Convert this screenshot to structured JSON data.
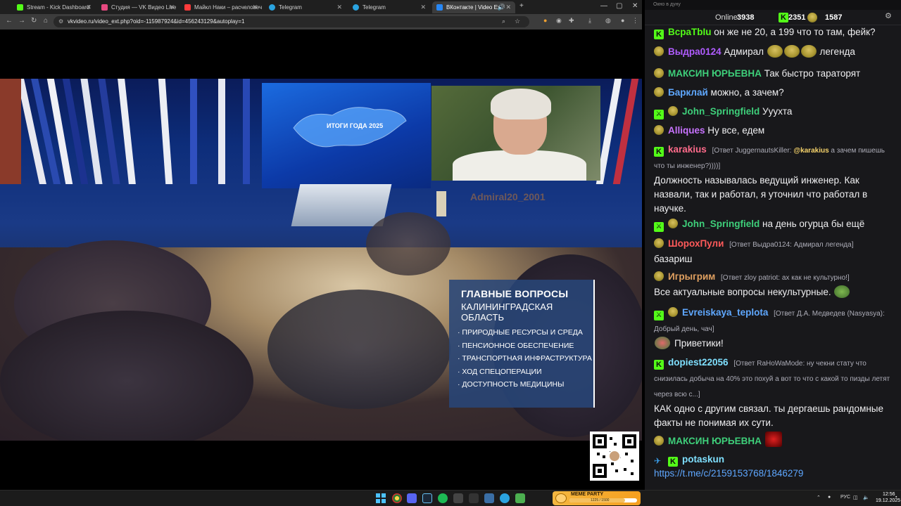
{
  "browser": {
    "tabs": [
      {
        "label": "Stream - Kick Dashboard",
        "color": "#53fc18"
      },
      {
        "label": "Студия — VK Видео Live",
        "color": "#e64980"
      },
      {
        "label": "Майкл Наки – расчеловечива...",
        "color": "#ff3b3b"
      },
      {
        "label": "Telegram",
        "color": "#2aa3e0"
      },
      {
        "label": "Telegram",
        "color": "#2aa3e0"
      },
      {
        "label": "ВКонтакте | Video Ext",
        "color": "#2787f5"
      }
    ],
    "new_tab": "+",
    "url": "vkvideo.ru/video_ext.php?oid=-115987924&id=456243129&autoplay=1",
    "minimize": "—",
    "maximize": "▢",
    "close": "✕"
  },
  "video": {
    "screen_text": "ИТОГИ ГОДА 2025",
    "watermark": "Admiral20_2001",
    "topics_title": "ГЛАВНЫЕ ВОПРОСЫ",
    "topics_subtitle": "КАЛИНИНГРАДСКАЯ ОБЛАСТЬ",
    "topics": [
      "· ПРИРОДНЫЕ РЕСУРСЫ И СРЕДА",
      "· ПЕНСИОННОЕ ОБЕСПЕЧЕНИЕ",
      "· ТРАНСПОРТНАЯ ИНФРАСТРУКТУРА",
      "· ХОД СПЕЦОПЕРАЦИИ",
      "· ДОСТУПНОСТЬ МЕДИЦИНЫ"
    ]
  },
  "chat": {
    "window_title": "Окно в дуну",
    "online_label": "Online:",
    "online_count": "3938",
    "kick_count": "2351",
    "pepe_count": "1587",
    "messages": [
      {
        "badges": [
          "k"
        ],
        "user": "ВсраТbIu",
        "user_color": "#53fc18",
        "text": "он же не 20, а 199 что то там, фейк?"
      },
      {
        "badges": [
          "pepe"
        ],
        "user": "Выдра0124",
        "user_color": "#b05cff",
        "text": "Адмирал",
        "emotes": 3,
        "text_after": "легенда"
      },
      {
        "badges": [
          "pepe"
        ],
        "user": "МАКСИН ЮРЬЕВНА",
        "user_color": "#3ecf7a",
        "text": "Так быстро тараторят"
      },
      {
        "badges": [
          "pepe"
        ],
        "user": "Барклай",
        "user_color": "#5fa8ff",
        "text": "можно, а зачем?"
      },
      {
        "badges": [
          "sword",
          "pepe"
        ],
        "user": "John_Springfield",
        "user_color": "#3ecf7a",
        "text": "Уууxта"
      },
      {
        "badges": [
          "pepe"
        ],
        "user": "Alliques",
        "user_color": "#c873ff",
        "text": "Ну все, едем"
      },
      {
        "badges": [
          "k"
        ],
        "user": "karakius",
        "user_color": "#ff6b8b",
        "reply": "[Ответ JuggernautsKiller: ",
        "reply_mention": "@karakius",
        "reply_tail": " а зачем пишешь что ты инженер?))))]",
        "text": "Должность называлась ведущий инженер. Как назвали, так и работал, я уточнил что работал в научке."
      },
      {
        "badges": [
          "sword",
          "pepe"
        ],
        "user": "John_Springfield",
        "user_color": "#3ecf7a",
        "text": "на день огурца бы ещё"
      },
      {
        "badges": [
          "pepe"
        ],
        "user": "ШорохПули",
        "user_color": "#ff5a5a",
        "reply": "[Ответ Выдра0124: Адмирал легенда]",
        "text": "базариш"
      },
      {
        "badges": [
          "pepe"
        ],
        "user": "Игрыгрим",
        "user_color": "#e0a060",
        "reply": "[Ответ zloy patriot: ах как не культурно!]",
        "text": "Все актуальные вопросы некультурные."
      },
      {
        "badges": [
          "sword",
          "pepe"
        ],
        "user": "Evreiskaya_teplota",
        "user_color": "#5fa8ff",
        "reply": "[Ответ Д.А. Медведев (Nasyasya): Добрый день, чач]",
        "text": "Приветики!"
      },
      {
        "badges": [
          "k"
        ],
        "user": "dopiest22056",
        "user_color": "#7fe0ff",
        "reply": "[Ответ RaHoWaMode: ну чекни стату что снизилась добыча на 40% это похуй а вот то что с какой то пизды летят через всю с...]",
        "text": "КАК одно с другим связал. ты дергаешь рандомные факты не понимая их сути."
      },
      {
        "badges": [
          "pepe"
        ],
        "user": "МАКСИН ЮРЬЕВНА",
        "user_color": "#3ecf7a",
        "text": ""
      },
      {
        "badges": [
          "blue",
          "k"
        ],
        "user": "potaskun",
        "user_color": "#7fe0ff",
        "text": "https://t.me/c/2159153768/1846279",
        "is_link": true
      }
    ]
  },
  "taskbar": {
    "meme_label": "MEME PARTY",
    "meme_count": "1225 / 1500",
    "lang": "РУС",
    "time": "12:56",
    "date": "19.12.2025"
  }
}
